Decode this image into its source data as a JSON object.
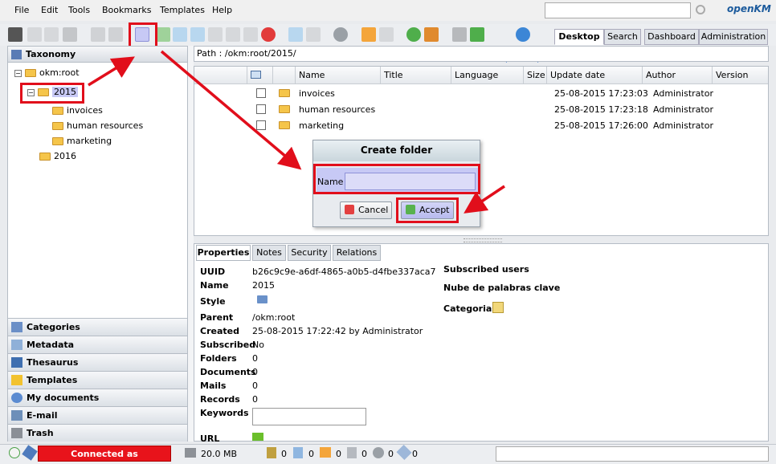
{
  "menu": {
    "items": [
      "File",
      "Edit",
      "Tools",
      "Bookmarks",
      "Templates",
      "Help"
    ],
    "logo": "openKM"
  },
  "top_tabs": [
    "Desktop",
    "Search",
    "Dashboard",
    "Administration"
  ],
  "left": {
    "header": "Taxonomy",
    "tree": {
      "root": "okm:root",
      "selected": "2015",
      "children_2015": [
        "invoices",
        "human resources",
        "marketing"
      ],
      "sibling": "2016"
    },
    "stack": [
      "Categories",
      "Metadata",
      "Thesaurus",
      "Templates",
      "My documents",
      "E-mail",
      "Trash"
    ]
  },
  "path": "Path : /okm:root/2015/",
  "grid": {
    "columns": [
      "Name",
      "Title",
      "Language",
      "Size",
      "Update date",
      "Author",
      "Version"
    ],
    "rows": [
      {
        "name": "invoices",
        "date": "25-08-2015 17:23:03",
        "author": "Administrator"
      },
      {
        "name": "human resources",
        "date": "25-08-2015 17:23:18",
        "author": "Administrator"
      },
      {
        "name": "marketing",
        "date": "25-08-2015 17:26:00",
        "author": "Administrator"
      }
    ]
  },
  "dialog": {
    "title": "Create folder",
    "name_label": "Name",
    "name_value": "",
    "cancel": "Cancel",
    "accept": "Accept"
  },
  "props": {
    "tabs": [
      "Properties",
      "Notes",
      "Security",
      "Relations"
    ],
    "fields": [
      {
        "label": "UUID",
        "value": "b26c9c9e-a6df-4865-a0b5-d4fbe337aca7"
      },
      {
        "label": "Name",
        "value": "2015"
      },
      {
        "label": "Style",
        "value": ""
      },
      {
        "label": "Parent",
        "value": "/okm:root"
      },
      {
        "label": "Created",
        "value": "25-08-2015 17:22:42 by Administrator"
      },
      {
        "label": "Subscribed",
        "value": "No"
      },
      {
        "label": "Folders",
        "value": "0"
      },
      {
        "label": "Documents",
        "value": "0"
      },
      {
        "label": "Mails",
        "value": "0"
      },
      {
        "label": "Records",
        "value": "0"
      },
      {
        "label": "Keywords",
        "value": ""
      },
      {
        "label": "URL",
        "value": ""
      }
    ],
    "right": [
      "Subscribed users",
      "Nube de palabras clave",
      "Categorias"
    ]
  },
  "status": {
    "connected": "Connected as Administrator",
    "memory": "20.0 MB",
    "counters": [
      "0",
      "0",
      "0",
      "0",
      "0",
      "0"
    ]
  },
  "colors": {
    "highlight": "#e10e1b",
    "accent": "#c7c9f5"
  }
}
